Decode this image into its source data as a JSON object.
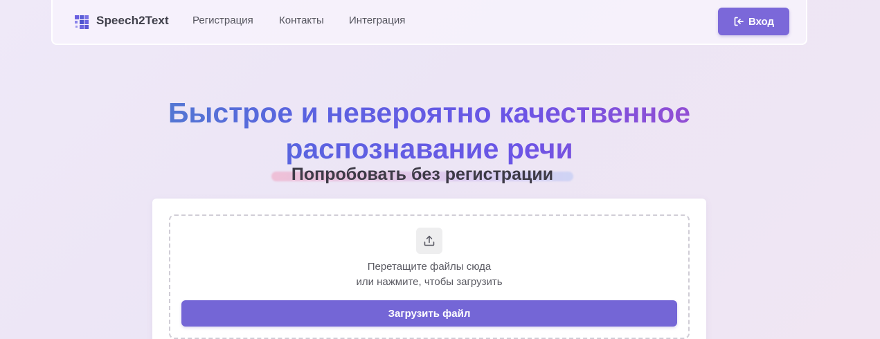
{
  "app": {
    "brand": "Speech2Text",
    "logo_icon": "grid-logo-icon",
    "accent_color": "#7466d6"
  },
  "nav": {
    "links": [
      {
        "label": "Регистрация"
      },
      {
        "label": "Контакты"
      },
      {
        "label": "Интеграция"
      }
    ],
    "login": {
      "label": "Вход",
      "icon": "login-icon"
    }
  },
  "hero": {
    "title_line1": "Быстрое и невероятно качественное",
    "title_line2": "распознавание речи",
    "subtitle": "Попробовать без регистрации"
  },
  "upload": {
    "icon": "upload-icon",
    "drop_text_line1": "Перетащите файлы сюда",
    "drop_text_line2": "или нажмите, чтобы загрузить",
    "button_label": "Загрузить файл"
  }
}
